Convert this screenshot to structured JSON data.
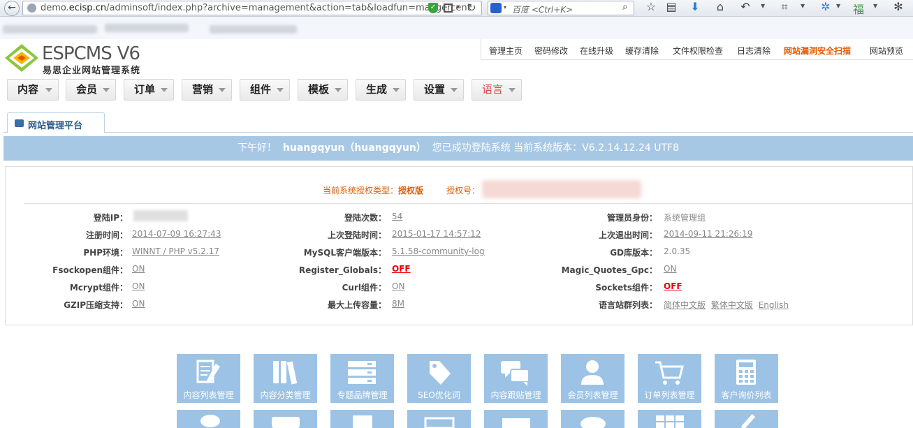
{
  "browser": {
    "url_prefix": "demo.",
    "url_domain": "ecisp.cn",
    "url_rest": "/adminsoft/index.php?archive=management&action=tab&loadfun=mangercent",
    "search_placeholder": "百度 <Ctrl+K>"
  },
  "header": {
    "logo_main": "ESPCMS",
    "logo_version": "V6",
    "logo_sub": "易思企业网站管理系统",
    "top_links": [
      "管理主页",
      "密码修改",
      "在线升级",
      "缓存清除",
      "文件权限检查",
      "日志清除",
      "网站漏洞安全扫描",
      "网站预览"
    ],
    "nav": [
      "内容",
      "会员",
      "订单",
      "营销",
      "组件",
      "模板",
      "生成",
      "设置",
      "语言"
    ]
  },
  "tab": {
    "label": "网站管理平台"
  },
  "welcome": {
    "greeting": "下午好！",
    "user": "huangqyun（huangqyun）",
    "msg": "您已成功登陆系统  当前系统版本：V6.2.14.12.24 UTF8"
  },
  "license": {
    "type_label": "当前系统授权类型：",
    "type_value": "授权版",
    "no_label": "授权号："
  },
  "info_rows": [
    [
      {
        "label": "登陆IP：",
        "value": ""
      },
      {
        "label": "登陆次数：",
        "value": "54"
      },
      {
        "label": "管理员身份：",
        "value": "系统管理组"
      }
    ],
    [
      {
        "label": "注册时间：",
        "value": "2014-07-09 16:27:43"
      },
      {
        "label": "上次登陆时间：",
        "value": "2015-01-17 14:57:12"
      },
      {
        "label": "上次退出时间：",
        "value": "2014-09-11 21:26:19"
      }
    ],
    [
      {
        "label": "PHP环境：",
        "value": "WINNT / PHP v5.2.17"
      },
      {
        "label": "MySQL客户端版本：",
        "value": "5.1.58-community-log"
      },
      {
        "label": "GD库版本：",
        "value": "2.0.35"
      }
    ],
    [
      {
        "label": "Fsockopen组件：",
        "value": "ON"
      },
      {
        "label": "Register_Globals：",
        "value": "OFF"
      },
      {
        "label": "Magic_Quotes_Gpc：",
        "value": "ON"
      }
    ],
    [
      {
        "label": "Mcrypt组件：",
        "value": "ON"
      },
      {
        "label": "Curl组件：",
        "value": "ON"
      },
      {
        "label": "Sockets组件：",
        "value": "OFF"
      }
    ],
    [
      {
        "label": "GZIP压缩支持：",
        "value": "ON"
      },
      {
        "label": "最大上传容量：",
        "value": "8M"
      },
      {
        "label": "语言站群列表：",
        "value": ""
      }
    ]
  ],
  "lang_sites": [
    "简体中文版",
    "繁体中文版",
    "English"
  ],
  "tiles": [
    "内容列表管理",
    "内容分类管理",
    "专题品牌管理",
    "SEO优化词",
    "内容跟贴管理",
    "会员列表管理",
    "订单列表管理",
    "客户询价列表"
  ],
  "colors": {
    "tile": "#9cc3e6",
    "welcome": "#a7c8e5",
    "warn": "#e05a00",
    "off": "#e00000"
  }
}
